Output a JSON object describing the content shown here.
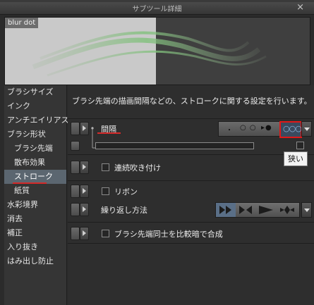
{
  "window": {
    "title": "サブツール詳細",
    "close_glyph": "×"
  },
  "preview": {
    "label": "blur dot"
  },
  "sidebar": {
    "items": [
      {
        "label": "ブラシサイズ",
        "sub": false,
        "selected": false
      },
      {
        "label": "インク",
        "sub": false,
        "selected": false
      },
      {
        "label": "アンチエイリアス",
        "sub": false,
        "selected": false
      },
      {
        "label": "ブラシ形状",
        "sub": false,
        "selected": false
      },
      {
        "label": "ブラシ先端",
        "sub": true,
        "selected": false
      },
      {
        "label": "散布効果",
        "sub": true,
        "selected": false
      },
      {
        "label": "ストローク",
        "sub": true,
        "selected": true
      },
      {
        "label": "紙質",
        "sub": true,
        "selected": false
      },
      {
        "label": "水彩境界",
        "sub": false,
        "selected": false
      },
      {
        "label": "消去",
        "sub": false,
        "selected": false
      },
      {
        "label": "補正",
        "sub": false,
        "selected": false
      },
      {
        "label": "入り抜き",
        "sub": false,
        "selected": false
      },
      {
        "label": "はみ出し防止",
        "sub": false,
        "selected": false
      }
    ]
  },
  "content": {
    "description": "ブラシ先端の描画間隔などの、ストロークに関する設定を行います。",
    "spacing": {
      "label": "間隔",
      "options": [
        "・",
        "○ ○",
        "▸●",
        "○○○"
      ],
      "selected": "○○○",
      "tooltip": "狭い"
    },
    "continuous_spray": {
      "label": "連続吹き付け",
      "checked": false
    },
    "ribbon": {
      "label": "リボン",
      "checked": false
    },
    "repeat_method": {
      "label": "繰り返し方法",
      "options": [
        "repeat-forward-icon",
        "reverse-icon",
        "forward-icon",
        "mirror-icon"
      ],
      "selected": "repeat-forward-icon"
    },
    "compare_density": {
      "label": "ブラシ先端同士を比較暗で合成",
      "checked": false
    }
  },
  "colors": {
    "accent_red": "#e01818",
    "selected_bg": "#5b6670",
    "panel_bg": "#2e2e2e"
  }
}
